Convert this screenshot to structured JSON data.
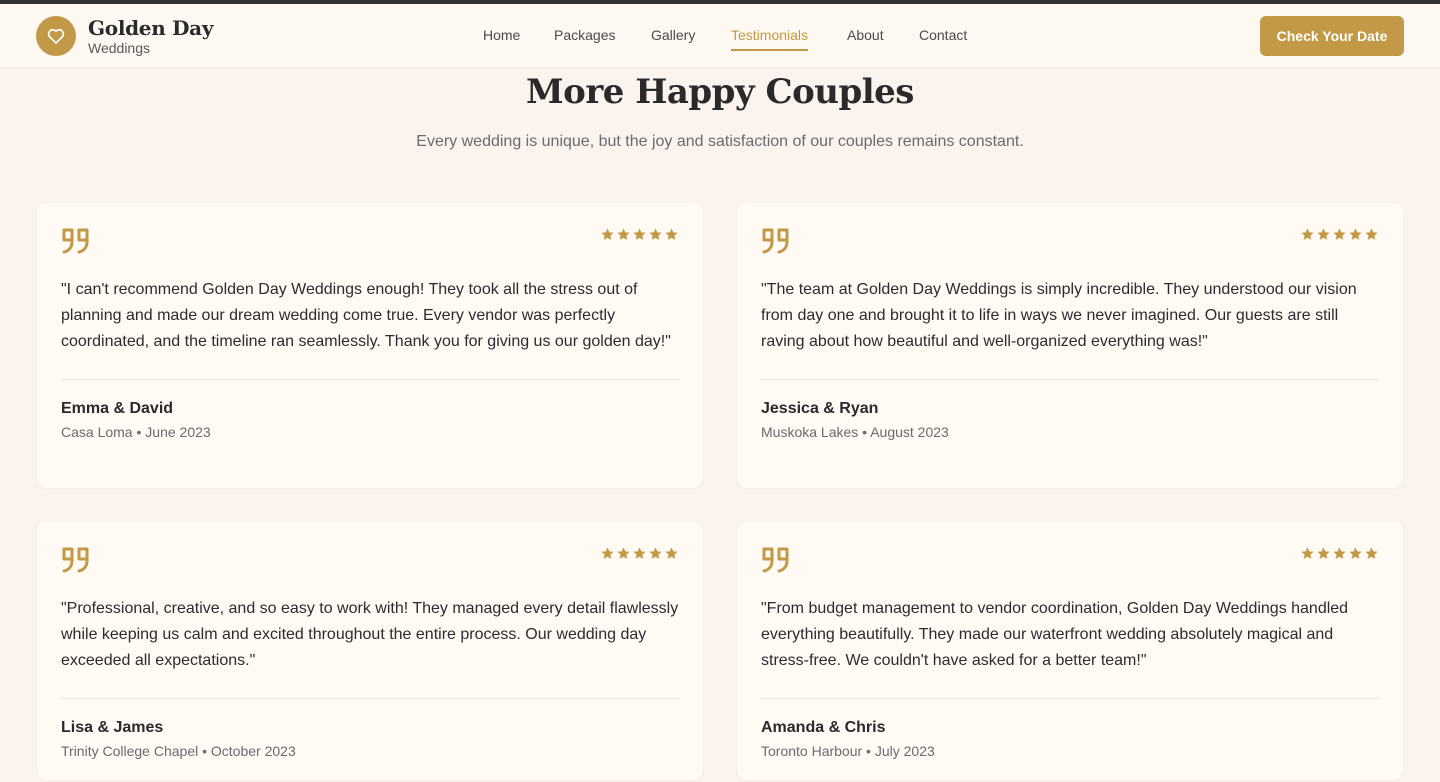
{
  "brand": {
    "title": "Golden Day",
    "subtitle": "Weddings",
    "icon": "heart-icon",
    "accent_color": "#c29a47"
  },
  "nav": {
    "items": [
      {
        "label": "Home"
      },
      {
        "label": "Packages"
      },
      {
        "label": "Gallery"
      },
      {
        "label": "Testimonials",
        "active": true
      },
      {
        "label": "About"
      },
      {
        "label": "Contact"
      }
    ],
    "cta_label": "Check Your Date"
  },
  "section": {
    "title": "More Happy Couples",
    "subtitle": "Every wedding is unique, but the joy and satisfaction of our couples remains constant."
  },
  "testimonials": [
    {
      "quote": "\"I can't recommend Golden Day Weddings enough! They took all the stress out of planning and made our dream wedding come true. Every vendor was perfectly coordinated, and the timeline ran seamlessly. Thank you for giving us our golden day!\"",
      "name": "Emma & David",
      "venue": "Casa Loma",
      "date": "June 2023",
      "rating": 5
    },
    {
      "quote": "\"The team at Golden Day Weddings is simply incredible. They understood our vision from day one and brought it to life in ways we never imagined. Our guests are still raving about how beautiful and well-organized everything was!\"",
      "name": "Jessica & Ryan",
      "venue": "Muskoka Lakes",
      "date": "August 2023",
      "rating": 5
    },
    {
      "quote": "\"Professional, creative, and so easy to work with! They managed every detail flawlessly while keeping us calm and excited throughout the entire process. Our wedding day exceeded all expectations.\"",
      "name": "Lisa & James",
      "venue": "Trinity College Chapel",
      "date": "October 2023",
      "rating": 5
    },
    {
      "quote": "\"From budget management to vendor coordination, Golden Day Weddings handled everything beautifully. They made our waterfront wedding absolutely magical and stress-free. We couldn't have asked for a better team!\"",
      "name": "Amanda & Chris",
      "venue": "Toronto Harbour",
      "date": "July 2023",
      "rating": 5
    }
  ]
}
